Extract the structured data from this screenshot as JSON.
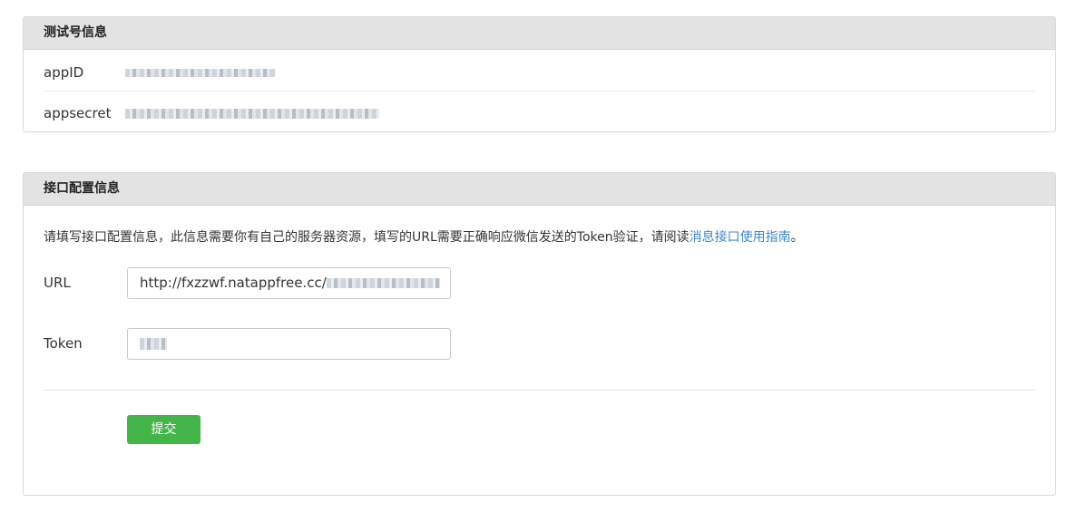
{
  "account_panel": {
    "title": "测试号信息",
    "rows": [
      {
        "label": "appID",
        "value_masked": true
      },
      {
        "label": "appsecret",
        "value_masked": true
      }
    ]
  },
  "config_panel": {
    "title": "接口配置信息",
    "intro_text": "请填写接口配置信息，此信息需要你有自己的服务器资源，填写的URL需要正确响应微信发送的Token验证，请阅读",
    "intro_link": "消息接口使用指南",
    "intro_end": "。",
    "url_label": "URL",
    "url_value": "http://fxzzwf.natappfree.cc/",
    "token_label": "Token",
    "submit_label": "提交"
  },
  "colors": {
    "header_bg": "#e3e3e3",
    "link": "#3f86c8",
    "submit_bg": "#44b549"
  }
}
